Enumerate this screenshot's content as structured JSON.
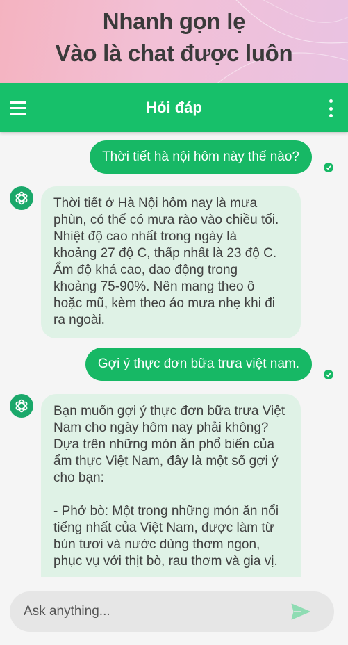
{
  "hero": {
    "line1": "Nhanh gọn lẹ",
    "line2": "Vào là chat được luôn"
  },
  "appbar": {
    "title": "Hỏi đáp",
    "left_icon": "menu-icon",
    "right_icon": "more-vert-icon"
  },
  "messages": [
    {
      "role": "user",
      "text": "Thời tiết hà nội hôm này thế nào?"
    },
    {
      "role": "bot",
      "lines": [
        "Thời tiết ở Hà Nội hôm nay là mưa",
        "phùn, có thể có mưa rào vào chiều tối.",
        "Nhiệt độ cao nhất trong ngày là",
        "khoảng 27 độ C, thấp nhất là 23 độ C.",
        "Ẩm độ khá cao, dao động trong",
        "khoảng 75-90%. Nên mang theo ô",
        "hoặc mũ, kèm theo áo mưa nhẹ khi đi",
        "ra ngoài."
      ]
    },
    {
      "role": "user",
      "text": "Gợi ý thực đơn bữa trưa việt nam."
    },
    {
      "role": "bot",
      "lines": [
        "Bạn muốn gợi ý thực đơn bữa trưa Việt",
        "Nam cho ngày hôm nay phải không?",
        "Dựa trên những món ăn phổ biến của",
        "ẩm thực Việt Nam, đây là một số gợi ý",
        "cho bạn:",
        "",
        "- Phở bò: Một trong những món ăn nổi",
        "tiếng nhất của Việt Nam, được làm từ",
        "bún tươi và nước dùng thơm ngon,",
        "phục vụ với thịt bò, rau thơm và gia vị."
      ]
    }
  ],
  "composer": {
    "placeholder": "Ask anything...",
    "send_icon": "send-icon"
  },
  "colors": {
    "appbar": "#17c06a",
    "user_bubble": "#17b865",
    "bot_bubble": "#dff2e6",
    "send": "#8fdcb3"
  }
}
